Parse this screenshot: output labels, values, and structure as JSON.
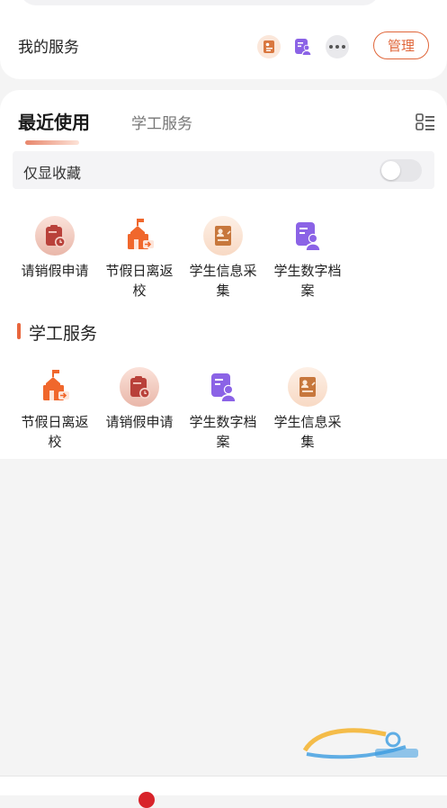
{
  "my_services": {
    "title": "我的服务",
    "manage_label": "管理",
    "shortcut_icons": [
      "student-info-icon",
      "student-archive-icon",
      "more-icon"
    ]
  },
  "tabs": [
    {
      "label": "最近使用",
      "active": true
    },
    {
      "label": "学工服务",
      "active": false
    }
  ],
  "favorites_only": {
    "label": "仅显收藏",
    "enabled": false
  },
  "recent": [
    {
      "label": "请销假申请",
      "icon": "leave-request-icon"
    },
    {
      "label": "节假日离返校",
      "icon": "holiday-return-icon"
    },
    {
      "label": "学生信息采集",
      "icon": "student-info-icon"
    },
    {
      "label": "学生数字档案",
      "icon": "student-archive-icon"
    }
  ],
  "section": {
    "title": "学工服务",
    "items": [
      {
        "label": "节假日离返校",
        "icon": "holiday-return-icon"
      },
      {
        "label": "请销假申请",
        "icon": "leave-request-icon"
      },
      {
        "label": "学生数字档案",
        "icon": "student-archive-icon"
      },
      {
        "label": "学生信息采集",
        "icon": "student-info-icon"
      }
    ]
  },
  "colors": {
    "accent": "#e0663a",
    "purple": "#8b63e6"
  }
}
